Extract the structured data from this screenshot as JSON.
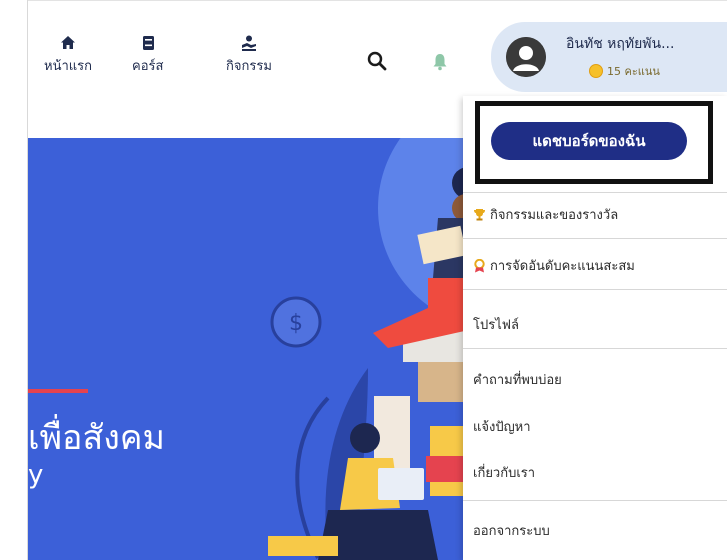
{
  "nav": {
    "items": [
      {
        "label": "หน้าแรก",
        "icon": "home-icon"
      },
      {
        "label": "คอร์ส",
        "icon": "book-icon"
      },
      {
        "label": "กิจกรรม",
        "icon": "activity-icon"
      }
    ],
    "search_icon": "search-icon",
    "bell_icon": "bell-icon"
  },
  "user": {
    "name": "อินทัช หฤทัยพัน...",
    "points": "15 คะแนน",
    "avatar_icon": "avatar-icon",
    "dropdown_icon": "chevron-down-icon"
  },
  "hero": {
    "title": "เพื่อสังคม",
    "subtitle": "y"
  },
  "menu": {
    "leaderboard_button": "แดชบอร์ดของฉัน",
    "items": [
      {
        "label": "กิจกรรมและของรางวัล",
        "icon": "trophy-icon"
      },
      {
        "label": "การจัดอันดับคะแนนสะสม",
        "icon": "ranking-icon"
      },
      {
        "label": "โปรไฟล์",
        "icon": ""
      },
      {
        "label": "คำถามที่พบบ่อย",
        "icon": ""
      },
      {
        "label": "แจ้งปัญหา",
        "icon": ""
      },
      {
        "label": "เกี่ยวกับเรา",
        "icon": ""
      },
      {
        "label": "ออกจากระบบ",
        "icon": ""
      }
    ]
  },
  "colors": {
    "primary": "#1f2e86",
    "hero_bg": "#3c60d8",
    "pill_bg": "#dde7f5",
    "accent_red": "#e5434f",
    "coin": "#f6c02a"
  }
}
